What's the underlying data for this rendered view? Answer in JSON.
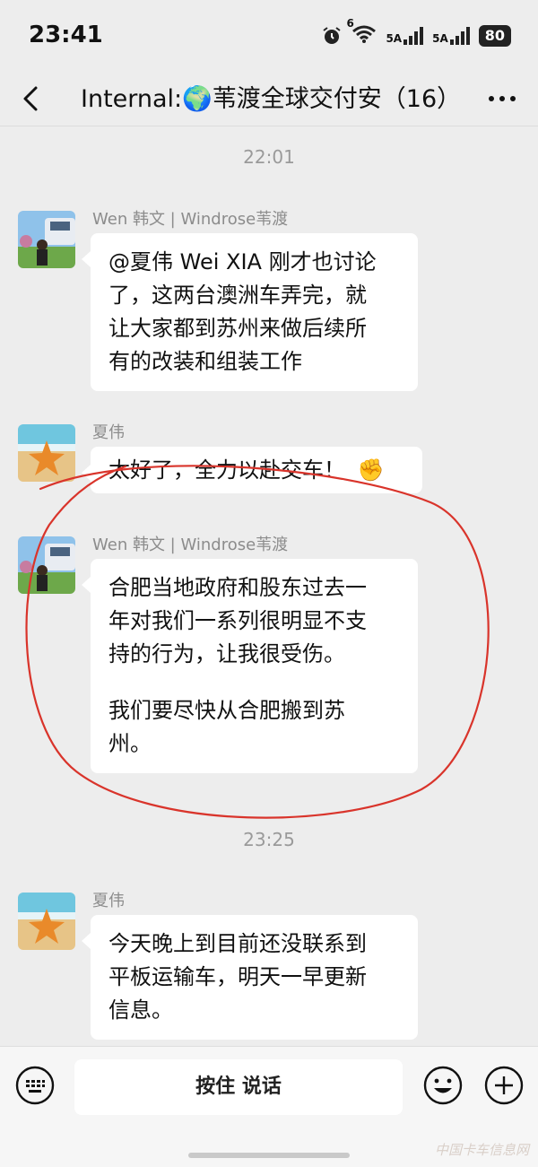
{
  "status_bar": {
    "time": "23:41",
    "battery": "80",
    "network_1": "5A",
    "network_2": "5A",
    "wifi_badge": "6"
  },
  "header": {
    "title": "Internal:🌍苇渡全球交付安",
    "member_count": "（16）",
    "icons": [
      "back-arrow-icon",
      "mute-bell-icon",
      "more-icon"
    ]
  },
  "timestamps": [
    "22:01",
    "23:25"
  ],
  "messages": [
    {
      "sender": "Wen 韩文 | Windrose苇渡",
      "avatar": "photo-avatar",
      "lines": [
        "@夏伟 Wei XIA 刚才也讨论",
        "了，这两台澳洲车弄完，就",
        "让大家都到苏州来做后续所",
        "有的改装和组装工作"
      ]
    },
    {
      "sender": "夏伟",
      "avatar": "starfish-avatar",
      "text": "太好了，全力以赴交车！",
      "emoji": "✊"
    },
    {
      "sender": "Wen 韩文 | Windrose苇渡",
      "avatar": "photo-avatar",
      "para1": [
        "合肥当地政府和股东过去一",
        "年对我们一系列很明显不支",
        "持的行为，让我很受伤。"
      ],
      "para2": [
        "我们要尽快从合肥搬到苏",
        "州。"
      ]
    },
    {
      "sender": "夏伟",
      "avatar": "starfish-avatar",
      "lines": [
        "今天晚上到目前还没联系到",
        "平板运输车，明天一早更新",
        "信息。"
      ]
    }
  ],
  "input_bar": {
    "hold_to_talk": "按住 说话",
    "icons": [
      "keyboard-icon",
      "emoji-icon",
      "plus-icon"
    ]
  },
  "watermark": "中国卡车信息网",
  "colors": {
    "background": "#ededed",
    "bubble": "#ffffff",
    "annotation": "#d9342b",
    "meta_text": "#8c8c8c"
  }
}
